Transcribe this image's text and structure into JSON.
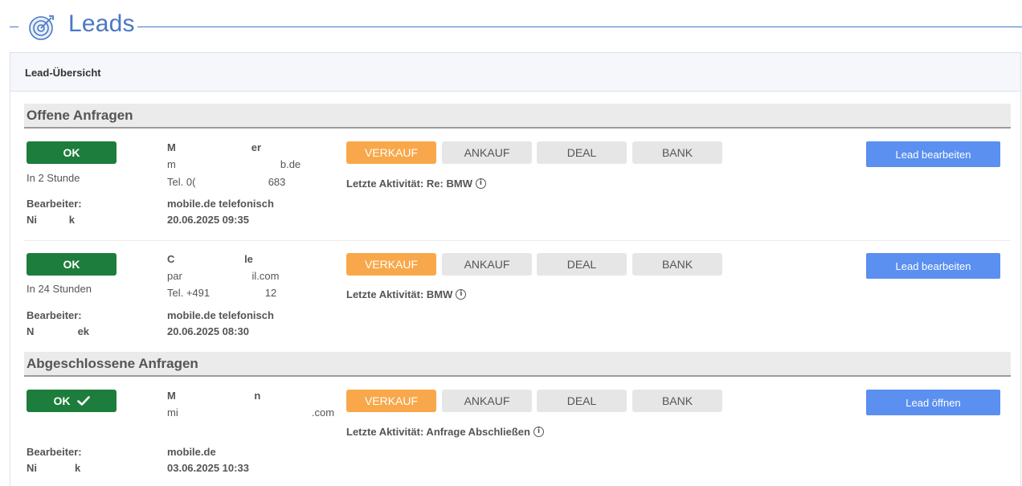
{
  "page": {
    "title": "Leads",
    "icon": "target-icon"
  },
  "panel": {
    "title": "Lead-Übersicht"
  },
  "sections": {
    "open": {
      "title": "Offene Anfragen"
    },
    "closed": {
      "title": "Abgeschlossene Anfragen"
    }
  },
  "tags": [
    "VERKAUF",
    "ANKAUF",
    "DEAL",
    "BANK"
  ],
  "leads": [
    {
      "status": "OK",
      "due": "In 2 Stunde",
      "assignee_label": "Bearbeiter:",
      "assignee": "Ni           k",
      "name": "M                          er",
      "email": "m                                    b.de",
      "phone": "Tel. 0(                         683",
      "source": "mobile.de telefonisch",
      "date": "20.06.2025 09:35",
      "active_tag": "VERKAUF",
      "activity": "Letzte Aktivität: Re: BMW",
      "action": "Lead bearbeiten"
    },
    {
      "status": "OK",
      "due": "In 24 Stunden",
      "assignee_label": "Bearbeiter:",
      "assignee": "N               ek",
      "name": "C                        le",
      "email": "par                        il.com",
      "phone": "Tel. +491                   12",
      "source": "mobile.de telefonisch",
      "date": "20.06.2025 08:30",
      "active_tag": "VERKAUF",
      "activity": "Letzte Aktivität: BMW",
      "action": "Lead bearbeiten"
    },
    {
      "status": "OK",
      "due": "",
      "assignee_label": "Bearbeiter:",
      "assignee": "Ni             k",
      "name": "M                           n",
      "email": "mi                                              .com",
      "phone": "",
      "source": "mobile.de",
      "date": "03.06.2025 10:33",
      "active_tag": "VERKAUF",
      "activity": "Letzte Aktivität: Anfrage Abschließen",
      "action": "Lead öffnen",
      "closed": true
    }
  ],
  "colors": {
    "accent": "#4a78c4",
    "ok": "#1d7d3c",
    "active_tag": "#f8a84a",
    "action": "#5b8ff0"
  }
}
